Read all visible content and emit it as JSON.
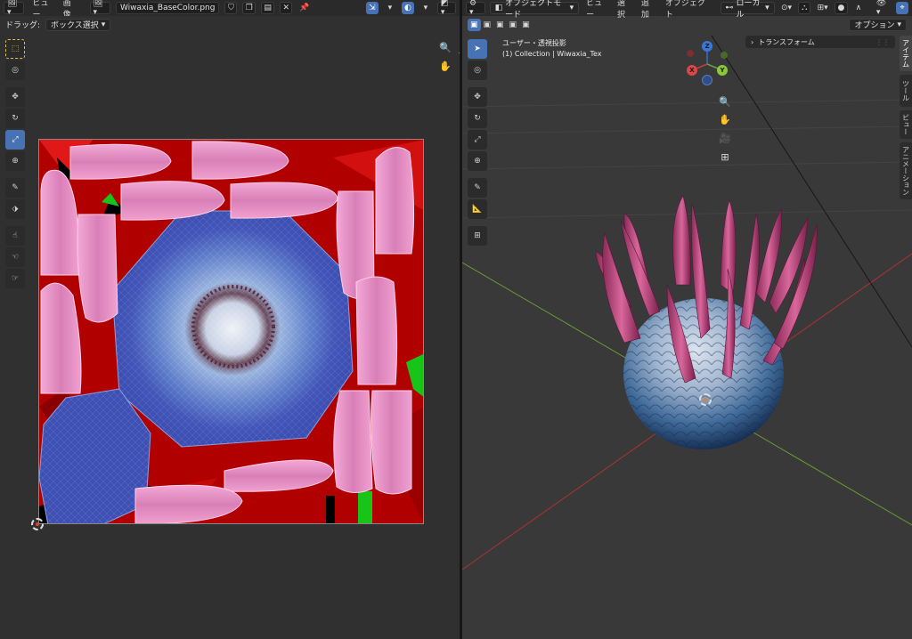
{
  "uv_editor": {
    "header": {
      "menus": [
        "ビュー",
        "画像"
      ],
      "image_name": "Wiwaxia_BaseColor.png"
    },
    "tool_header": {
      "drag_label": "ドラッグ:",
      "drag_value": "ボックス選択"
    }
  },
  "viewport": {
    "header": {
      "mode": "オブジェクトモード",
      "menus": [
        "ビュー",
        "選択",
        "追加",
        "オブジェクト"
      ],
      "transform_orientation": "ローカル"
    },
    "options_label": "オプション",
    "overlay": {
      "view_name": "ユーザー・透視投影",
      "collection_info": "(1) Collection | Wiwaxia_Tex"
    },
    "transform_panel_label": "トランスフォーム",
    "side_tabs": [
      "アイテム",
      "ツール",
      "ビュー",
      "アニメーション"
    ],
    "gizmo": {
      "x": "X",
      "y": "Y",
      "z": "Z"
    }
  },
  "colors": {
    "accent": "#4772b3",
    "uv_background": "#b00000",
    "petal": "#e98cc6",
    "body_blue": "#3d4fb3"
  }
}
